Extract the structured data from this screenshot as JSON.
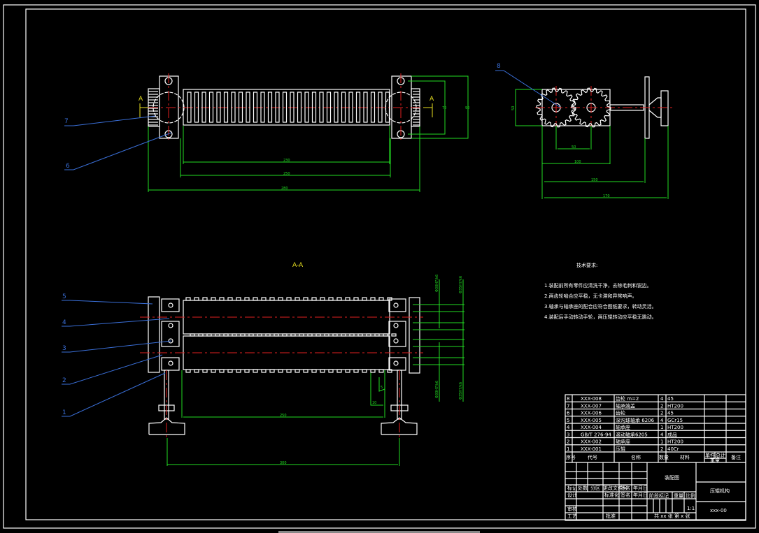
{
  "colors": {
    "background": "#000000",
    "outline": "#ffffff",
    "dimension": "#22dd22",
    "centerline": "#e02020",
    "leader": "#3a6fd8",
    "hatch": "#6fdede",
    "section_mark": "#e8e020"
  },
  "section_marks": {
    "left": "A",
    "right": "A",
    "section_title": "A-A"
  },
  "leaders": [
    "1",
    "2",
    "3",
    "4",
    "5",
    "6",
    "7",
    "8"
  ],
  "dimensions": {
    "top_inner": "230",
    "top_mid": "250",
    "top_overall": "280",
    "top_height": "90",
    "top_height_inner": "70",
    "gear_height": "50",
    "gear_center": "50",
    "gear_box": "100",
    "gear_shaft": "150",
    "gear_overall": "170",
    "sec_roller": "250",
    "sec_feet": "300",
    "sec_small_1": "10",
    "sec_small_2": "5",
    "fit_1": "Φ30H7/k6",
    "fit_2": "Φ35H7/k6",
    "fit_3": "Φ30H7/k6",
    "fit_4": "Φ35H7/k6"
  },
  "tech_requirements": {
    "title": "技术要求:",
    "items": [
      "1.装配前所有零件应清洗干净，去除毛刺和锐边。",
      "2.两齿轮啮合应平稳，无卡滞和异常响声。",
      "3.轴承与轴承座的配合应符合图纸要求，转动灵活。",
      "4.装配后手动转动手轮，两压辊转动应平稳无跳动。"
    ]
  },
  "parts_table": {
    "rows": [
      {
        "no": "8",
        "code": "XXX-008",
        "name": "齿轮 m=2",
        "qty": "4",
        "material": "45"
      },
      {
        "no": "7",
        "code": "XXX-007",
        "name": "轴承端盖",
        "qty": "2",
        "material": "HT200"
      },
      {
        "no": "6",
        "code": "XXX-006",
        "name": "齿轮",
        "qty": "2",
        "material": "45"
      },
      {
        "no": "5",
        "code": "XXX-005",
        "name": "深沟球轴承 6206",
        "qty": "4",
        "material": "GCr15"
      },
      {
        "no": "4",
        "code": "XXX-004",
        "name": "轴承座",
        "qty": "1",
        "material": "HT200"
      },
      {
        "no": "3",
        "code": "GB/T 276-94",
        "name": "滚动轴承6205",
        "qty": "4",
        "material": "成品"
      },
      {
        "no": "2",
        "code": "XXX-002",
        "name": "轴承座",
        "qty": "1",
        "material": "HT200"
      },
      {
        "no": "1",
        "code": "XXX-001",
        "name": "压辊",
        "qty": "2",
        "material": "40Cr"
      }
    ],
    "headers": {
      "no": "序号",
      "code": "代号",
      "name": "名称",
      "qty": "数量",
      "material": "材料",
      "single": "单件",
      "total": "总计",
      "weight": "重量",
      "remark": "备注"
    }
  },
  "title_block": {
    "mark": "标记",
    "count": "处数",
    "zone": "分区",
    "change_doc": "更改文件号",
    "sign": "签名",
    "date": "年月日",
    "design": "设计",
    "standard": "标准化",
    "sign2": "签名",
    "date2": "年月日",
    "check": "审核",
    "process": "工艺",
    "approve": "批准",
    "drawing_title": "装配图",
    "stage": "阶段标记",
    "weight": "重量",
    "scale": "比例",
    "scale_value": "1:1",
    "sheets": "共 xx 张 第 x 张",
    "name": "压辊机构",
    "drawing_no": "xxx-00"
  }
}
